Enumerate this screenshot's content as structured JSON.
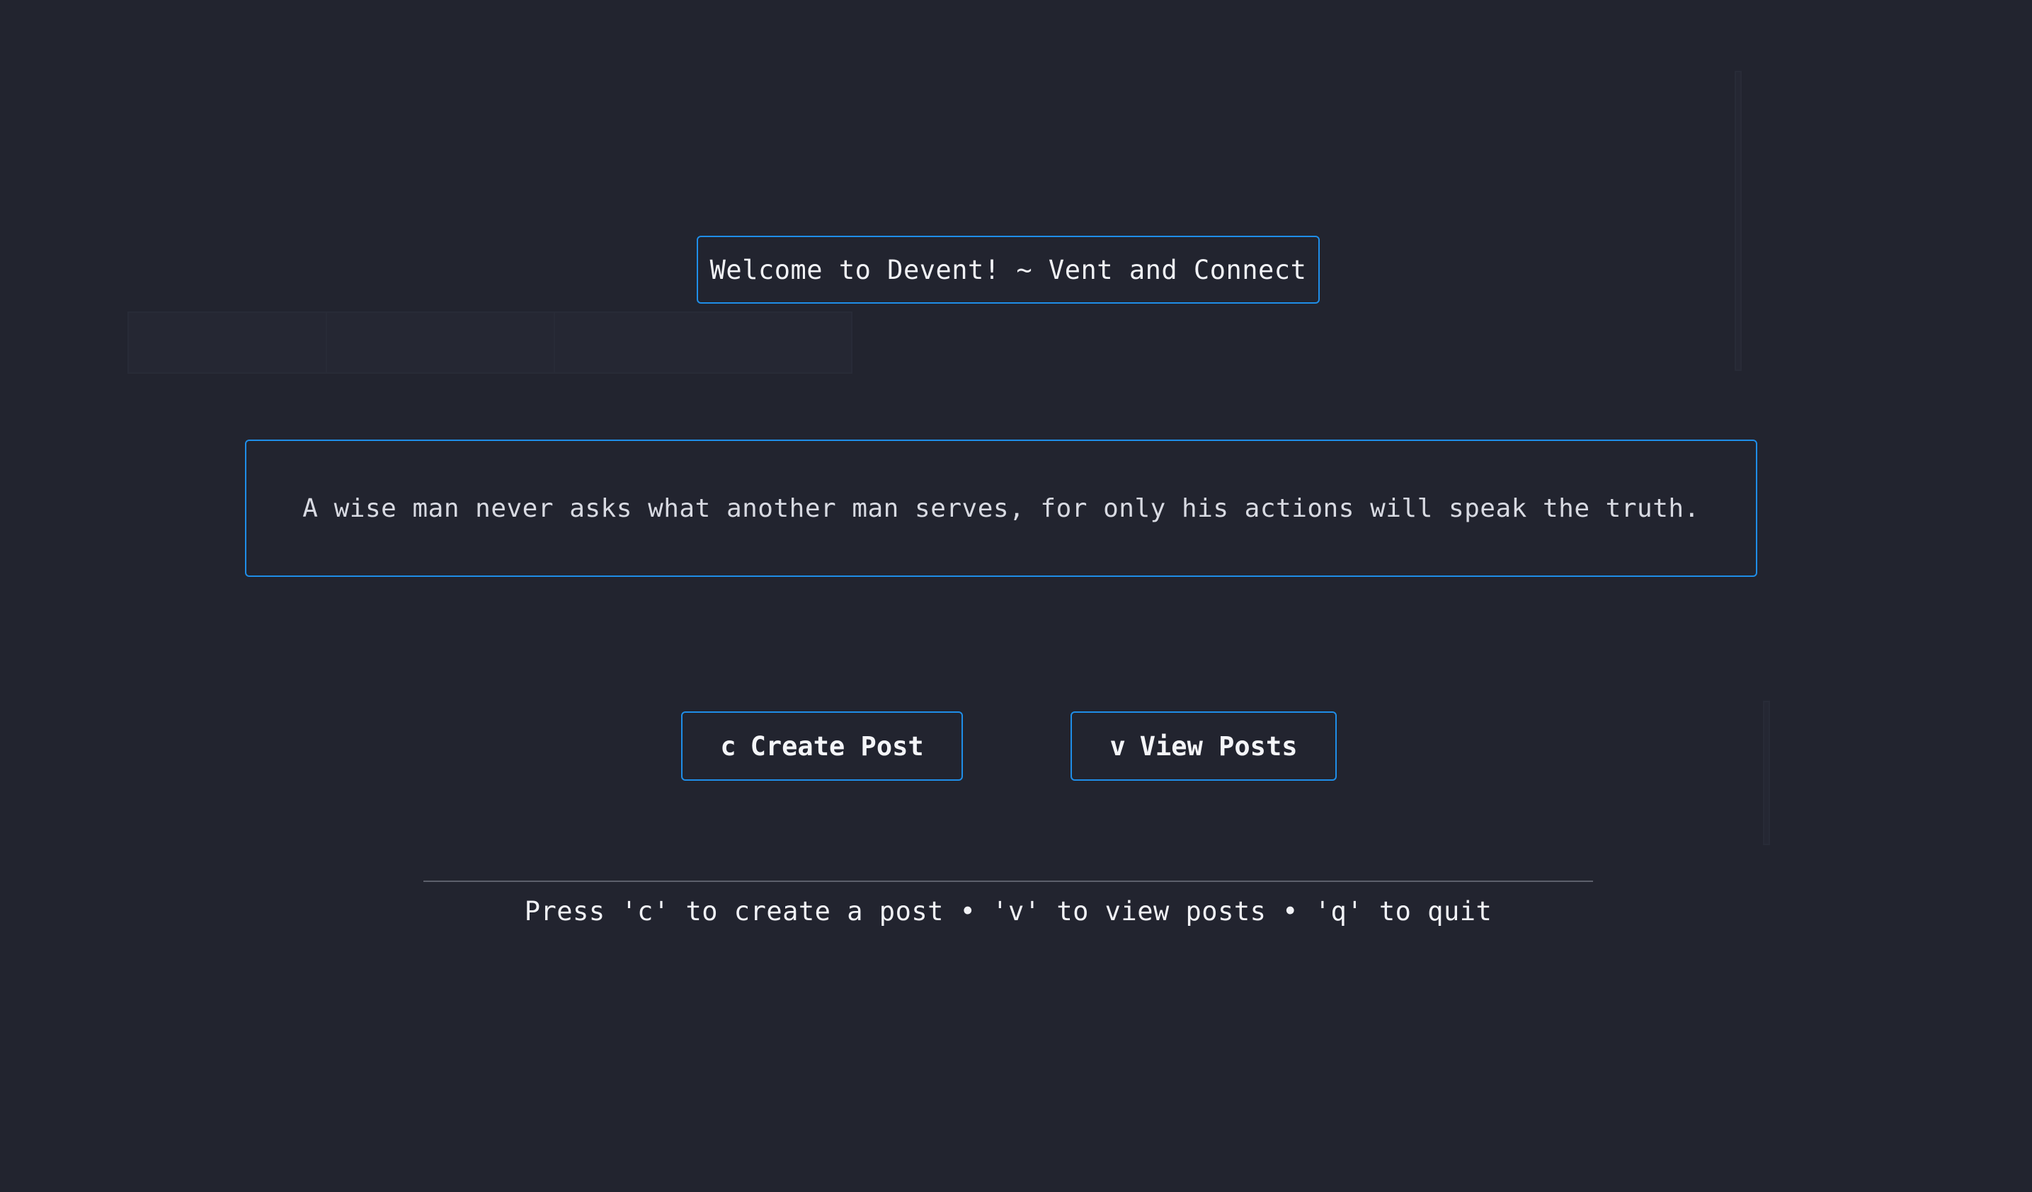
{
  "app": {
    "title": "Welcome to Devent! ~ Vent and Connect"
  },
  "quote": {
    "text": "A wise man never asks what another man serves, for only his actions will speak the truth."
  },
  "buttons": {
    "create": {
      "key": "c",
      "label": "Create Post"
    },
    "view": {
      "key": "v",
      "label": "View Posts"
    }
  },
  "help": {
    "text": "Press 'c' to create a post • 'v' to view posts • 'q' to quit"
  },
  "colors": {
    "background": "#22242f",
    "accent_border": "#1f8ee8",
    "text": "#f1f2f6",
    "divider": "#5d606c"
  }
}
